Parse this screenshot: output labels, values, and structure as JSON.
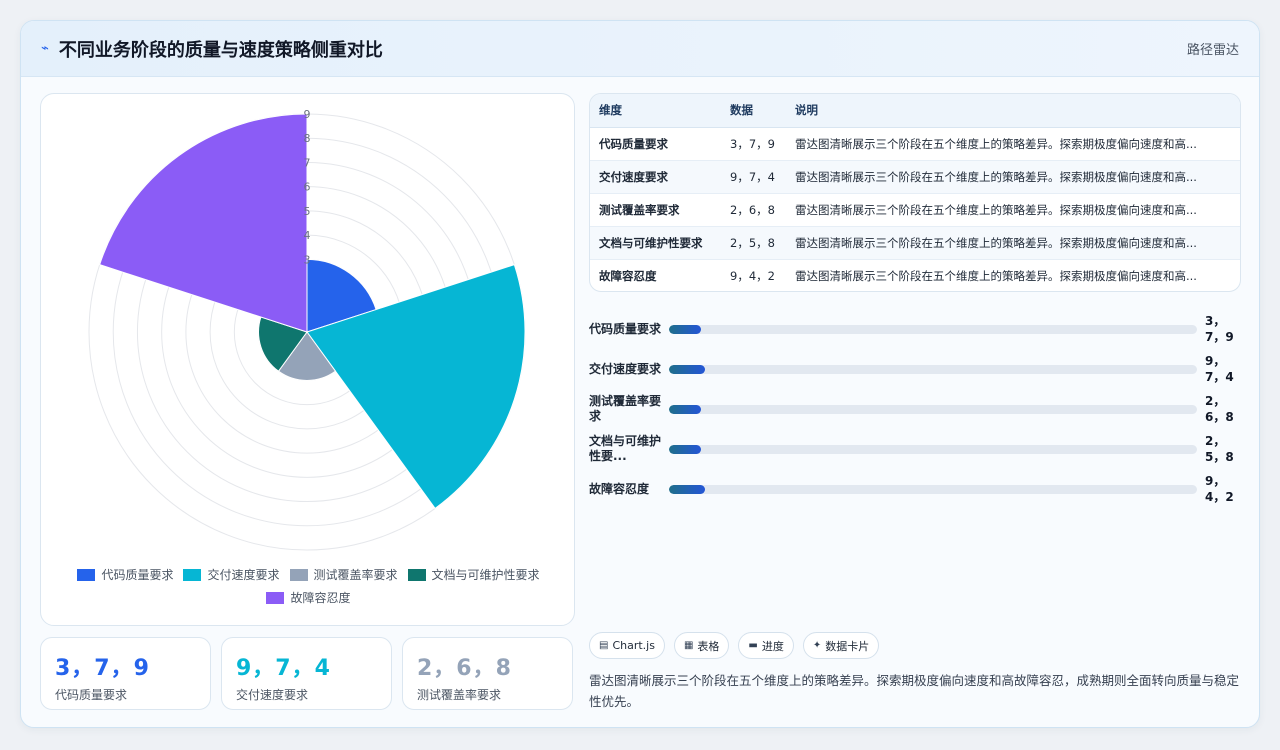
{
  "header": {
    "title": "不同业务阶段的质量与速度策略侧重对比",
    "tag": "路径雷达"
  },
  "chart_data": {
    "type": "polar-area",
    "categories": [
      "代码质量要求",
      "交付速度要求",
      "测试覆盖率要求",
      "文档与可维护性要求",
      "故障容忍度"
    ],
    "values": [
      3,
      9,
      2,
      2,
      9
    ],
    "colors": [
      "#2563eb",
      "#06b6d4",
      "#94a3b8",
      "#0f766e",
      "#8b5cf6"
    ],
    "r_ticks": [
      3,
      4,
      5,
      6,
      7,
      8,
      9
    ],
    "rlim": [
      0,
      9
    ],
    "legend": "bottom"
  },
  "kpis": [
    {
      "value": "3，7，9",
      "label": "代码质量要求",
      "color": "#2563eb"
    },
    {
      "value": "9，7，4",
      "label": "交付速度要求",
      "color": "#06b6d4"
    },
    {
      "value": "2，6，8",
      "label": "测试覆盖率要求",
      "color": "#94a3b8"
    }
  ],
  "table": {
    "headers": [
      "维度",
      "数据",
      "说明"
    ],
    "rows": [
      {
        "dim": "代码质量要求",
        "data": "3，7，9",
        "desc": "雷达图清晰展示三个阶段在五个维度上的策略差异。探索期极度偏向速度和高..."
      },
      {
        "dim": "交付速度要求",
        "data": "9，7，4",
        "desc": "雷达图清晰展示三个阶段在五个维度上的策略差异。探索期极度偏向速度和高..."
      },
      {
        "dim": "测试覆盖率要求",
        "data": "2，6，8",
        "desc": "雷达图清晰展示三个阶段在五个维度上的策略差异。探索期极度偏向速度和高..."
      },
      {
        "dim": "文档与可维护性要求",
        "data": "2，5，8",
        "desc": "雷达图清晰展示三个阶段在五个维度上的策略差异。探索期极度偏向速度和高..."
      },
      {
        "dim": "故障容忍度",
        "data": "9，4，2",
        "desc": "雷达图清晰展示三个阶段在五个维度上的策略差异。探索期极度偏向速度和高..."
      }
    ]
  },
  "bars": [
    {
      "label": "代码质量要求",
      "value": "3，7，9",
      "fraction": 0.06
    },
    {
      "label": "交付速度要求",
      "value": "9，7，4",
      "fraction": 0.068
    },
    {
      "label": "测试覆盖率要求",
      "value": "2，6，8",
      "fraction": 0.06
    },
    {
      "label": "文档与可维护性要...",
      "value": "2，5，8",
      "fraction": 0.06
    },
    {
      "label": "故障容忍度",
      "value": "9，4，2",
      "fraction": 0.068
    }
  ],
  "tags": [
    {
      "icon": "chart-icon",
      "glyph": "▤",
      "label": "Chart.js"
    },
    {
      "icon": "table-icon",
      "glyph": "▦",
      "label": "表格"
    },
    {
      "icon": "progress-icon",
      "glyph": "▬",
      "label": "进度"
    },
    {
      "icon": "card-icon",
      "glyph": "✦",
      "label": "数据卡片"
    }
  ],
  "description": "雷达图清晰展示三个阶段在五个维度上的策略差异。探索期极度偏向速度和高故障容忍，成熟期则全面转向质量与稳定性优先。"
}
